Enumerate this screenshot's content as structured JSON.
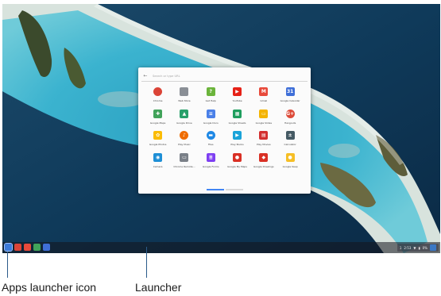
{
  "launcher": {
    "search_placeholder": "Search or type URL",
    "apps": [
      {
        "label": "Chrome",
        "icon": "chrome-icon",
        "color": "#db4437",
        "glyph": "",
        "round": true
      },
      {
        "label": "Web Store",
        "icon": "web-store-icon",
        "color": "#8a8f96",
        "glyph": "",
        "round": false
      },
      {
        "label": "Get Help",
        "icon": "help-icon",
        "color": "#6bb43b",
        "glyph": "?",
        "round": false
      },
      {
        "label": "YouTube",
        "icon": "youtube-icon",
        "color": "#e62117",
        "glyph": "▶",
        "round": false
      },
      {
        "label": "Gmail",
        "icon": "gmail-icon",
        "color": "#e84a3b",
        "glyph": "M",
        "round": false
      },
      {
        "label": "Google Calendar",
        "icon": "calendar-icon",
        "color": "#3f6fd8",
        "glyph": "31",
        "round": false
      },
      {
        "label": "Google Maps",
        "icon": "maps-icon",
        "color": "#41a35a",
        "glyph": "✚",
        "round": false
      },
      {
        "label": "Google Drive",
        "icon": "drive-icon",
        "color": "#27a06a",
        "glyph": "▲",
        "round": false
      },
      {
        "label": "Google Docs",
        "icon": "docs-icon",
        "color": "#4a80e8",
        "glyph": "≡",
        "round": false
      },
      {
        "label": "Google Sheets",
        "icon": "sheets-icon",
        "color": "#1f9e5e",
        "glyph": "▦",
        "round": false
      },
      {
        "label": "Google Slides",
        "icon": "slides-icon",
        "color": "#f4b400",
        "glyph": "▭",
        "round": false
      },
      {
        "label": "Hangouts",
        "icon": "google-plus-icon",
        "color": "#dd4b39",
        "glyph": "G+",
        "round": true
      },
      {
        "label": "Google Photos",
        "icon": "photos-icon",
        "color": "#fbbc05",
        "glyph": "✿",
        "round": false
      },
      {
        "label": "Play Music",
        "icon": "play-music-icon",
        "color": "#ef6c00",
        "glyph": "♪",
        "round": true
      },
      {
        "label": "Files",
        "icon": "files-icon",
        "color": "#1e88e5",
        "glyph": "▬",
        "round": true
      },
      {
        "label": "Play Books",
        "icon": "play-books-icon",
        "color": "#1aa3d9",
        "glyph": "▶",
        "round": false
      },
      {
        "label": "Play Movies",
        "icon": "play-movies-icon",
        "color": "#d32f2f",
        "glyph": "▤",
        "round": false
      },
      {
        "label": "Calculator",
        "icon": "calculator-icon",
        "color": "#455a64",
        "glyph": "±",
        "round": false
      },
      {
        "label": "Camera",
        "icon": "camera-icon",
        "color": "#1e8fd6",
        "glyph": "◉",
        "round": false
      },
      {
        "label": "Chrome Remote...",
        "icon": "remote-desktop-icon",
        "color": "#7a8088",
        "glyph": "▭",
        "round": false
      },
      {
        "label": "Google Forms",
        "icon": "forms-icon",
        "color": "#7e3ff2",
        "glyph": "≣",
        "round": false
      },
      {
        "label": "Google My Maps",
        "icon": "my-maps-icon",
        "color": "#d93025",
        "glyph": "●",
        "round": false
      },
      {
        "label": "Google Drawings",
        "icon": "drawings-icon",
        "color": "#d93025",
        "glyph": "◆",
        "round": false
      },
      {
        "label": "Google Keep",
        "icon": "keep-icon",
        "color": "#f6bf26",
        "glyph": "●",
        "round": false
      }
    ]
  },
  "shelf": {
    "apps": [
      {
        "icon": "apps-launcher-icon",
        "color": "#3d7bd9"
      },
      {
        "icon": "chrome-icon",
        "color": "#db4437"
      },
      {
        "icon": "gmail-icon",
        "color": "#e84a3b"
      },
      {
        "icon": "maps-icon",
        "color": "#41a35a"
      },
      {
        "icon": "calendar-icon",
        "color": "#3f6fd8"
      }
    ],
    "status": {
      "page": "1",
      "time": "2:53",
      "battery": "0%"
    }
  },
  "callouts": {
    "apps_launcher_icon": "Apps launcher icon",
    "launcher": "Launcher"
  }
}
